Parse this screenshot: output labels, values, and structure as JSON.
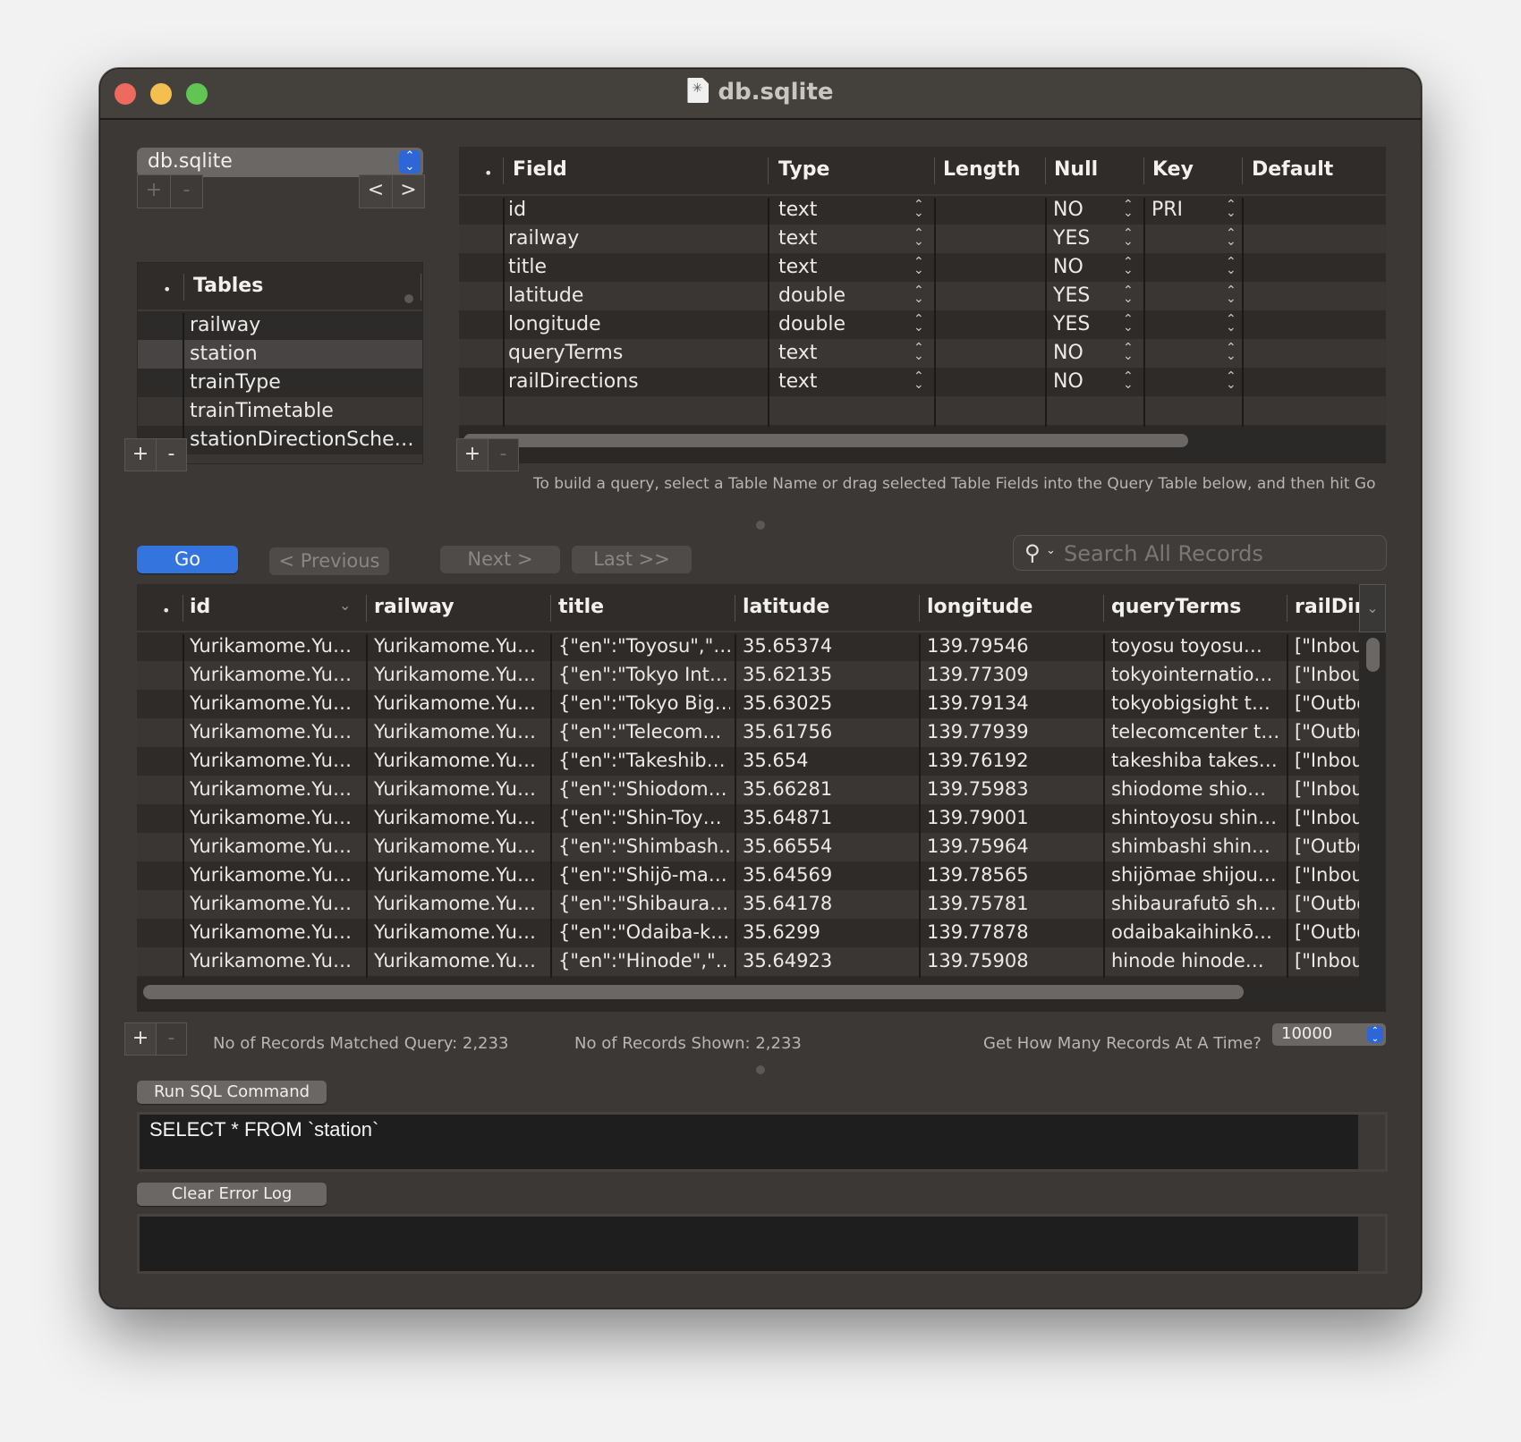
{
  "window": {
    "title": "db.sqlite",
    "title_icon": "sqlite-document-icon"
  },
  "database_popup": {
    "selected": "db.sqlite"
  },
  "db_buttons": {
    "add": "+",
    "remove": "-",
    "back": "<",
    "forward": ">"
  },
  "tables_panel": {
    "header": "Tables",
    "header_marker": "•",
    "items": [
      {
        "label": "railway",
        "selected": false
      },
      {
        "label": "station",
        "selected": true
      },
      {
        "label": "trainType",
        "selected": false
      },
      {
        "label": "trainTimetable",
        "selected": false
      },
      {
        "label": "stationDirectionSche…",
        "selected": false
      }
    ],
    "add": "+",
    "remove": "-"
  },
  "schema_table": {
    "marker": "•",
    "columns": [
      "Field",
      "Type",
      "Length",
      "Null",
      "Key",
      "Default"
    ],
    "rows": [
      {
        "field": "id",
        "type": "text",
        "length": "",
        "null": "NO",
        "key": "PRI",
        "default": ""
      },
      {
        "field": "railway",
        "type": "text",
        "length": "",
        "null": "YES",
        "key": "",
        "default": ""
      },
      {
        "field": "title",
        "type": "text",
        "length": "",
        "null": "NO",
        "key": "",
        "default": ""
      },
      {
        "field": "latitude",
        "type": "double",
        "length": "",
        "null": "YES",
        "key": "",
        "default": ""
      },
      {
        "field": "longitude",
        "type": "double",
        "length": "",
        "null": "YES",
        "key": "",
        "default": ""
      },
      {
        "field": "queryTerms",
        "type": "text",
        "length": "",
        "null": "NO",
        "key": "",
        "default": ""
      },
      {
        "field": "railDirections",
        "type": "text",
        "length": "",
        "null": "NO",
        "key": "",
        "default": ""
      }
    ],
    "add": "+",
    "remove": "-",
    "hint": "To build a query, select a Table Name or drag selected Table Fields into the Query Table below, and then hit Go"
  },
  "query_buttons": {
    "go": "Go",
    "previous": "< Previous",
    "next": "Next >",
    "last": "Last >>"
  },
  "search": {
    "placeholder": "Search All Records",
    "icon": "search-icon"
  },
  "data_grid": {
    "marker": "•",
    "columns": [
      "id",
      "railway",
      "title",
      "latitude",
      "longitude",
      "queryTerms",
      "railDire"
    ],
    "sorted_column": "id",
    "rows": [
      [
        "Yurikamome.Yu…",
        "Yurikamome.Yu…",
        "{\"en\":\"Toyosu\",\"…",
        "35.65374",
        "139.79546",
        "toyosu toyosu…",
        "[\"Inbou"
      ],
      [
        "Yurikamome.Yu…",
        "Yurikamome.Yu…",
        "{\"en\":\"Tokyo Int…",
        "35.62135",
        "139.77309",
        "tokyointernatio…",
        "[\"Inbou"
      ],
      [
        "Yurikamome.Yu…",
        "Yurikamome.Yu…",
        "{\"en\":\"Tokyo Big…",
        "35.63025",
        "139.79134",
        "tokyobigsight t…",
        "[\"Outbo"
      ],
      [
        "Yurikamome.Yu…",
        "Yurikamome.Yu…",
        "{\"en\":\"Telecom…",
        "35.61756",
        "139.77939",
        "telecomcenter t…",
        "[\"Outbo"
      ],
      [
        "Yurikamome.Yu…",
        "Yurikamome.Yu…",
        "{\"en\":\"Takeshib…",
        "35.654",
        "139.76192",
        "takeshiba takes…",
        "[\"Inbou"
      ],
      [
        "Yurikamome.Yu…",
        "Yurikamome.Yu…",
        "{\"en\":\"Shiodom…",
        "35.66281",
        "139.75983",
        "shiodome shio…",
        "[\"Inbou"
      ],
      [
        "Yurikamome.Yu…",
        "Yurikamome.Yu…",
        "{\"en\":\"Shin-Toy…",
        "35.64871",
        "139.79001",
        "shintoyosu shin…",
        "[\"Inbou"
      ],
      [
        "Yurikamome.Yu…",
        "Yurikamome.Yu…",
        "{\"en\":\"Shimbash…",
        "35.66554",
        "139.75964",
        "shimbashi shin…",
        "[\"Outbo"
      ],
      [
        "Yurikamome.Yu…",
        "Yurikamome.Yu…",
        "{\"en\":\"Shijō-ma…",
        "35.64569",
        "139.78565",
        "shijōmae shijou…",
        "[\"Inbou"
      ],
      [
        "Yurikamome.Yu…",
        "Yurikamome.Yu…",
        "{\"en\":\"Shibaura…",
        "35.64178",
        "139.75781",
        "shibaurafutō sh…",
        "[\"Outbo"
      ],
      [
        "Yurikamome.Yu…",
        "Yurikamome.Yu…",
        "{\"en\":\"Odaiba-k…",
        "35.6299",
        "139.77878",
        "odaibakaihinkō…",
        "[\"Outbo"
      ],
      [
        "Yurikamome.Yu…",
        "Yurikamome.Yu…",
        "{\"en\":\"Hinode\",\"…",
        "35.64923",
        "139.75908",
        "hinode hinode…",
        "[\"Inbou"
      ]
    ],
    "add": "+",
    "remove": "-"
  },
  "footer": {
    "matched": "No of Records Matched Query: 2,233",
    "shown": "No of Records Shown: 2,233",
    "fetch_label": "Get How Many Records At A Time?",
    "fetch_value": "10000"
  },
  "sql": {
    "run_label": "Run SQL Command",
    "command": "SELECT * FROM `station`",
    "clear_log_label": "Clear Error Log",
    "error_log": ""
  }
}
